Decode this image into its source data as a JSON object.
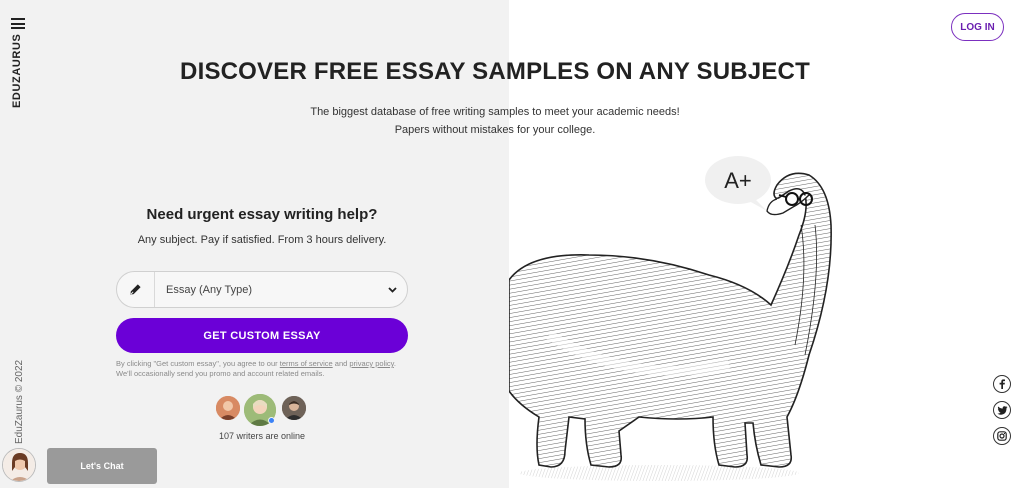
{
  "brand": {
    "name": "EDUZAURUS",
    "copyright": "EduZaurus © 2022"
  },
  "header": {
    "login_label": "LOG IN"
  },
  "hero": {
    "title": "DISCOVER FREE ESSAY SAMPLES ON ANY SUBJECT",
    "subtitle_line1": "The biggest database of free writing samples to meet your academic needs!",
    "subtitle_line2": "Papers without mistakes for your college."
  },
  "form": {
    "title": "Need urgent essay writing help?",
    "subtitle": "Any subject. Pay if satisfied. From 3 hours delivery.",
    "type_select_value": "Essay (Any Type)",
    "cta_label": "GET CUSTOM ESSAY",
    "legal_prefix": "By clicking \"Get custom essay\", you agree to our",
    "terms_link": "terms of service",
    "legal_and": "and",
    "privacy_link": "privacy policy",
    "legal_suffix": ". We'll occasionally send you promo and account related emails."
  },
  "writers": {
    "online_text": "107 writers are online"
  },
  "speech_bubble": "A+",
  "chat": {
    "label": "Let's Chat"
  },
  "social": [
    "facebook-icon",
    "twitter-icon",
    "instagram-icon"
  ],
  "colors": {
    "accent": "#6b00d7",
    "login_border": "#7b2fbf",
    "left_bg": "#f2f2f2"
  }
}
